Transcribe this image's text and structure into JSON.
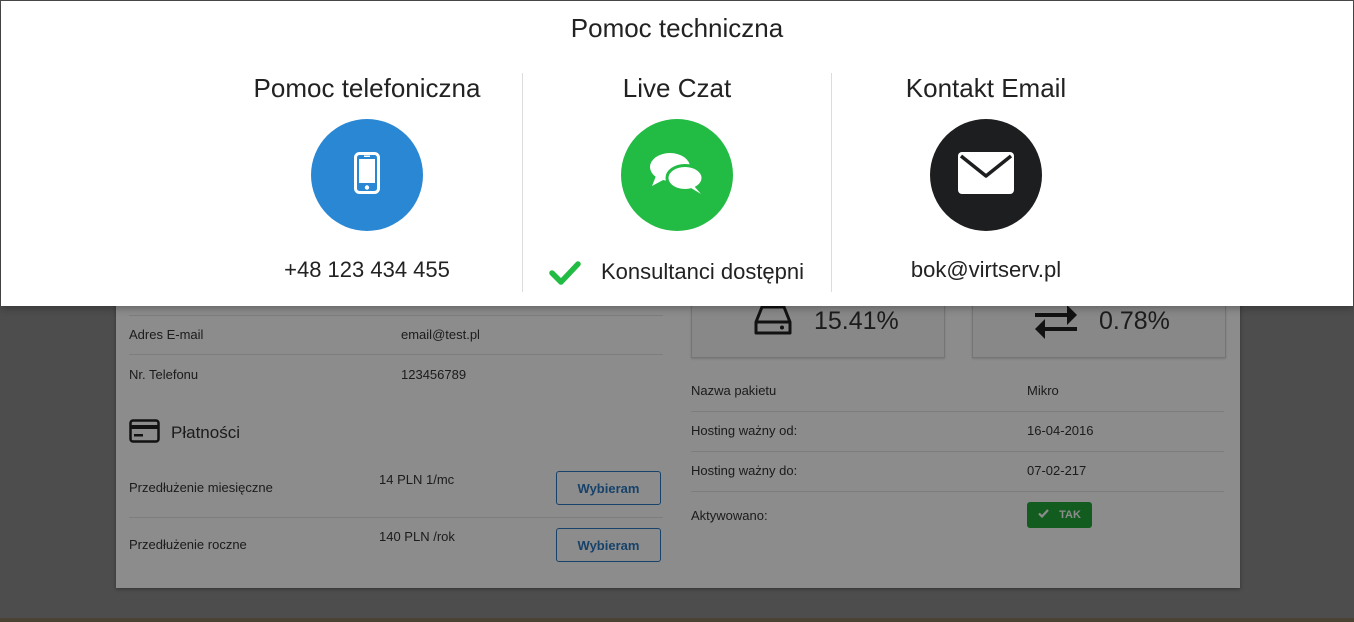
{
  "modal": {
    "title": "Pomoc techniczna",
    "phone": {
      "title": "Pomoc telefoniczna",
      "icon": "smartphone-icon",
      "color": "#2a87d4",
      "value": "+48 123 434 455"
    },
    "chat": {
      "title": "Live Czat",
      "icon": "chat-bubbles-icon",
      "color": "#22bb44",
      "status": "Konsultanci dostępni",
      "status_icon": "checkmark-icon"
    },
    "email": {
      "title": "Kontakt Email",
      "icon": "envelope-icon",
      "color": "#1d1e20",
      "value": "bok@virtserv.pl"
    }
  },
  "account": {
    "rows": [
      {
        "label": "Adres E-mail",
        "value": "email@test.pl"
      },
      {
        "label": "Nr. Telefonu",
        "value": "123456789"
      }
    ]
  },
  "payments": {
    "heading": "Płatności",
    "icon": "credit-card-icon",
    "rows": [
      {
        "label": "Przedłużenie miesięczne",
        "price": "14 PLN 1/mc",
        "button": "Wybieram"
      },
      {
        "label": "Przedłużenie roczne",
        "price": "140 PLN /rok",
        "button": "Wybieram"
      }
    ]
  },
  "stats": [
    {
      "icon": "hard-drive-icon",
      "value": "15.41%"
    },
    {
      "icon": "transfer-arrows-icon",
      "value": "0.78%"
    }
  ],
  "package": {
    "rows": [
      {
        "label": "Nazwa pakietu",
        "value": "Mikro"
      },
      {
        "label": "Hosting ważny od:",
        "value": "16-04-2016"
      },
      {
        "label": "Hosting ważny do:",
        "value": "07-02-217"
      },
      {
        "label": "Aktywowano:",
        "badge": "TAK"
      }
    ],
    "badge_color": "#22a83a"
  }
}
